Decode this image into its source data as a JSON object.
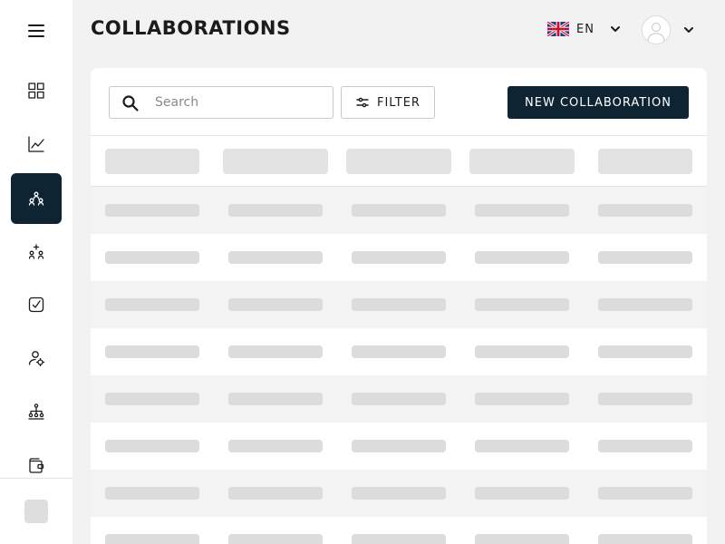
{
  "sidebar": {
    "menu_icon": "hamburger-menu-icon",
    "items": [
      {
        "id": "dashboard",
        "icon": "grid-icon",
        "active": false
      },
      {
        "id": "analytics",
        "icon": "line-chart-icon",
        "active": false
      },
      {
        "id": "collaborations",
        "icon": "people-network-icon",
        "active": true
      },
      {
        "id": "add-collaboration",
        "icon": "people-add-icon",
        "active": false
      },
      {
        "id": "tasks",
        "icon": "checkbox-icon",
        "active": false
      },
      {
        "id": "contacts",
        "icon": "user-settings-icon",
        "active": false
      },
      {
        "id": "hierarchy",
        "icon": "hierarchy-icon",
        "active": false
      },
      {
        "id": "wallet",
        "icon": "wallet-icon",
        "active": false
      }
    ]
  },
  "header": {
    "title": "COLLABORATIONS",
    "language": {
      "code": "EN",
      "flag": "uk-flag-icon"
    },
    "user": {
      "avatar_icon": "user-avatar-icon"
    }
  },
  "toolbar": {
    "search_placeholder": "Search",
    "search_value": "",
    "filter_label": "FILTER",
    "new_label": "NEW COLLABORATION"
  },
  "table": {
    "state": "loading",
    "column_count": 5,
    "skeleton_row_count": 8
  },
  "colors": {
    "primary": "#0f2433",
    "background": "#f2f2f2",
    "skeleton": "#dcdcdc"
  }
}
